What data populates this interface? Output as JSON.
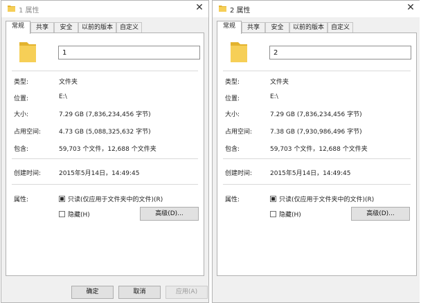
{
  "dialogs": [
    {
      "title": "1 属性",
      "close": "✕",
      "tabs": [
        "常规",
        "共享",
        "安全",
        "以前的版本",
        "自定义"
      ],
      "active_tab": "常规",
      "name_value": "1",
      "fields": [
        {
          "label": "类型:",
          "value": "文件夹"
        },
        {
          "label": "位置:",
          "value": "E:\\"
        },
        {
          "label": "大小:",
          "value": "7.29 GB (7,836,234,456 字节)"
        },
        {
          "label": "占用空间:",
          "value": "4.73 GB (5,088,325,632 字节)"
        },
        {
          "label": "包含:",
          "value": "59,703 个文件，12,688 个文件夹"
        },
        {
          "label": "创建时间:",
          "value": "2015年5月14日，14:49:45"
        }
      ],
      "attributes_label": "属性:",
      "readonly_label": "只读(仅应用于文件夹中的文件)(R)",
      "readonly_checked": true,
      "hidden_label": "隐藏(H)",
      "hidden_checked": false,
      "advanced_label": "高级(D)...",
      "buttons": {
        "ok": "确定",
        "cancel": "取消",
        "apply": "应用(A)"
      }
    },
    {
      "title": "2 属性",
      "close": "✕",
      "tabs": [
        "常规",
        "共享",
        "安全",
        "以前的版本",
        "自定义"
      ],
      "active_tab": "常规",
      "name_value": "2",
      "fields": [
        {
          "label": "类型:",
          "value": "文件夹"
        },
        {
          "label": "位置:",
          "value": "E:\\"
        },
        {
          "label": "大小:",
          "value": "7.29 GB (7,836,234,456 字节)"
        },
        {
          "label": "占用空间:",
          "value": "7.38 GB (7,930,986,496 字节)"
        },
        {
          "label": "包含:",
          "value": "59,703 个文件，12,688 个文件夹"
        },
        {
          "label": "创建时间:",
          "value": "2015年5月14日，14:49:45"
        }
      ],
      "attributes_label": "属性:",
      "readonly_label": "只读(仅应用于文件夹中的文件)(R)",
      "readonly_checked": true,
      "hidden_label": "隐藏(H)",
      "hidden_checked": false,
      "advanced_label": "高级(D)..."
    }
  ],
  "colors": {
    "folder": "#f6cf57",
    "folder_dark": "#e3b32f",
    "panel": "#ffffff",
    "dialog_bg": "#f0f0f0"
  },
  "icons": {
    "title": "folder-icon",
    "close": "close-icon"
  }
}
